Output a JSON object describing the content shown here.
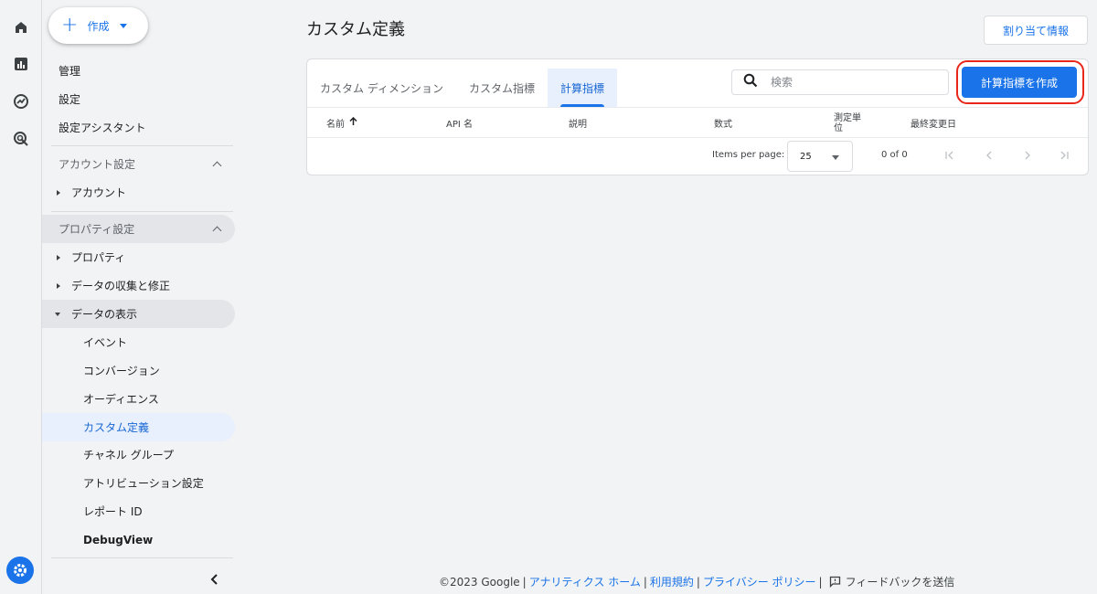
{
  "nav": {
    "create_label": "作成",
    "top_items": [
      "管理",
      "設定",
      "設定アシスタント"
    ],
    "account_section": "アカウント設定",
    "account_item": "アカウント",
    "property_section": "プロパティ設定",
    "property_items": [
      "プロパティ",
      "データの収集と修正"
    ],
    "data_display": "データの表示",
    "data_display_children": [
      "イベント",
      "コンバージョン",
      "オーディエンス",
      "カスタム定義",
      "チャネル グループ",
      "アトリビューション設定",
      "レポート ID",
      "DebugView"
    ]
  },
  "main": {
    "title": "カスタム定義",
    "assign_button": "割り当て情報",
    "tabs": [
      "カスタム ディメンション",
      "カスタム指標",
      "計算指標"
    ],
    "active_tab": "計算指標",
    "search_placeholder": "検索",
    "create_button": "計算指標を作成",
    "columns": {
      "name": "名前",
      "api": "API 名",
      "description": "説明",
      "formula": "数式",
      "unit_line1": "測定単",
      "unit_line2": "位",
      "modified": "最終変更日"
    },
    "pager": {
      "items_per_page_label": "Items per page:",
      "page_size": "25",
      "range": "0 of 0"
    }
  },
  "footer": {
    "copyright": "©2023 Google",
    "link_home": "アナリティクス ホーム",
    "link_terms": "利用規約",
    "link_privacy": "プライバシー ポリシー",
    "feedback": "フィードバックを送信"
  },
  "colors": {
    "accent": "#1a73e8",
    "highlight_ring": "#e8261a",
    "background": "#f1f3f4"
  }
}
